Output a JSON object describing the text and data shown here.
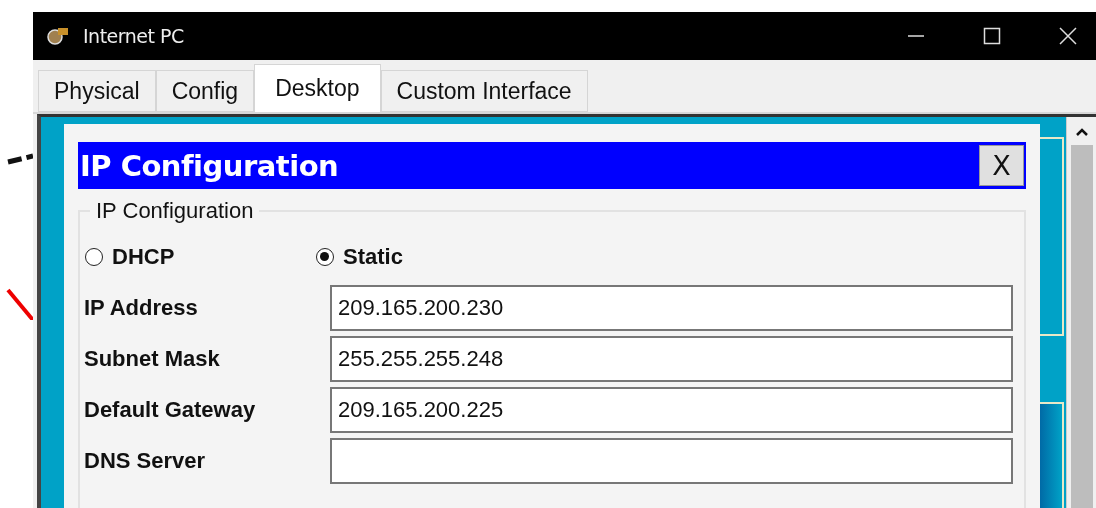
{
  "window": {
    "title": "Internet PC"
  },
  "tabs": [
    {
      "label": "Physical",
      "selected": false
    },
    {
      "label": "Config",
      "selected": false
    },
    {
      "label": "Desktop",
      "selected": true
    },
    {
      "label": "Custom Interface",
      "selected": false
    }
  ],
  "dialog": {
    "title": "IP Configuration",
    "close_label": "X",
    "group": {
      "legend": "IP Configuration",
      "modes": [
        {
          "label": "DHCP",
          "selected": false
        },
        {
          "label": "Static",
          "selected": true
        }
      ],
      "fields": [
        {
          "label": "IP Address",
          "value": "209.165.200.230"
        },
        {
          "label": "Subnet Mask",
          "value": "255.255.255.248"
        },
        {
          "label": "Default Gateway",
          "value": "209.165.200.225"
        },
        {
          "label": "DNS Server"
        }
      ]
    }
  }
}
